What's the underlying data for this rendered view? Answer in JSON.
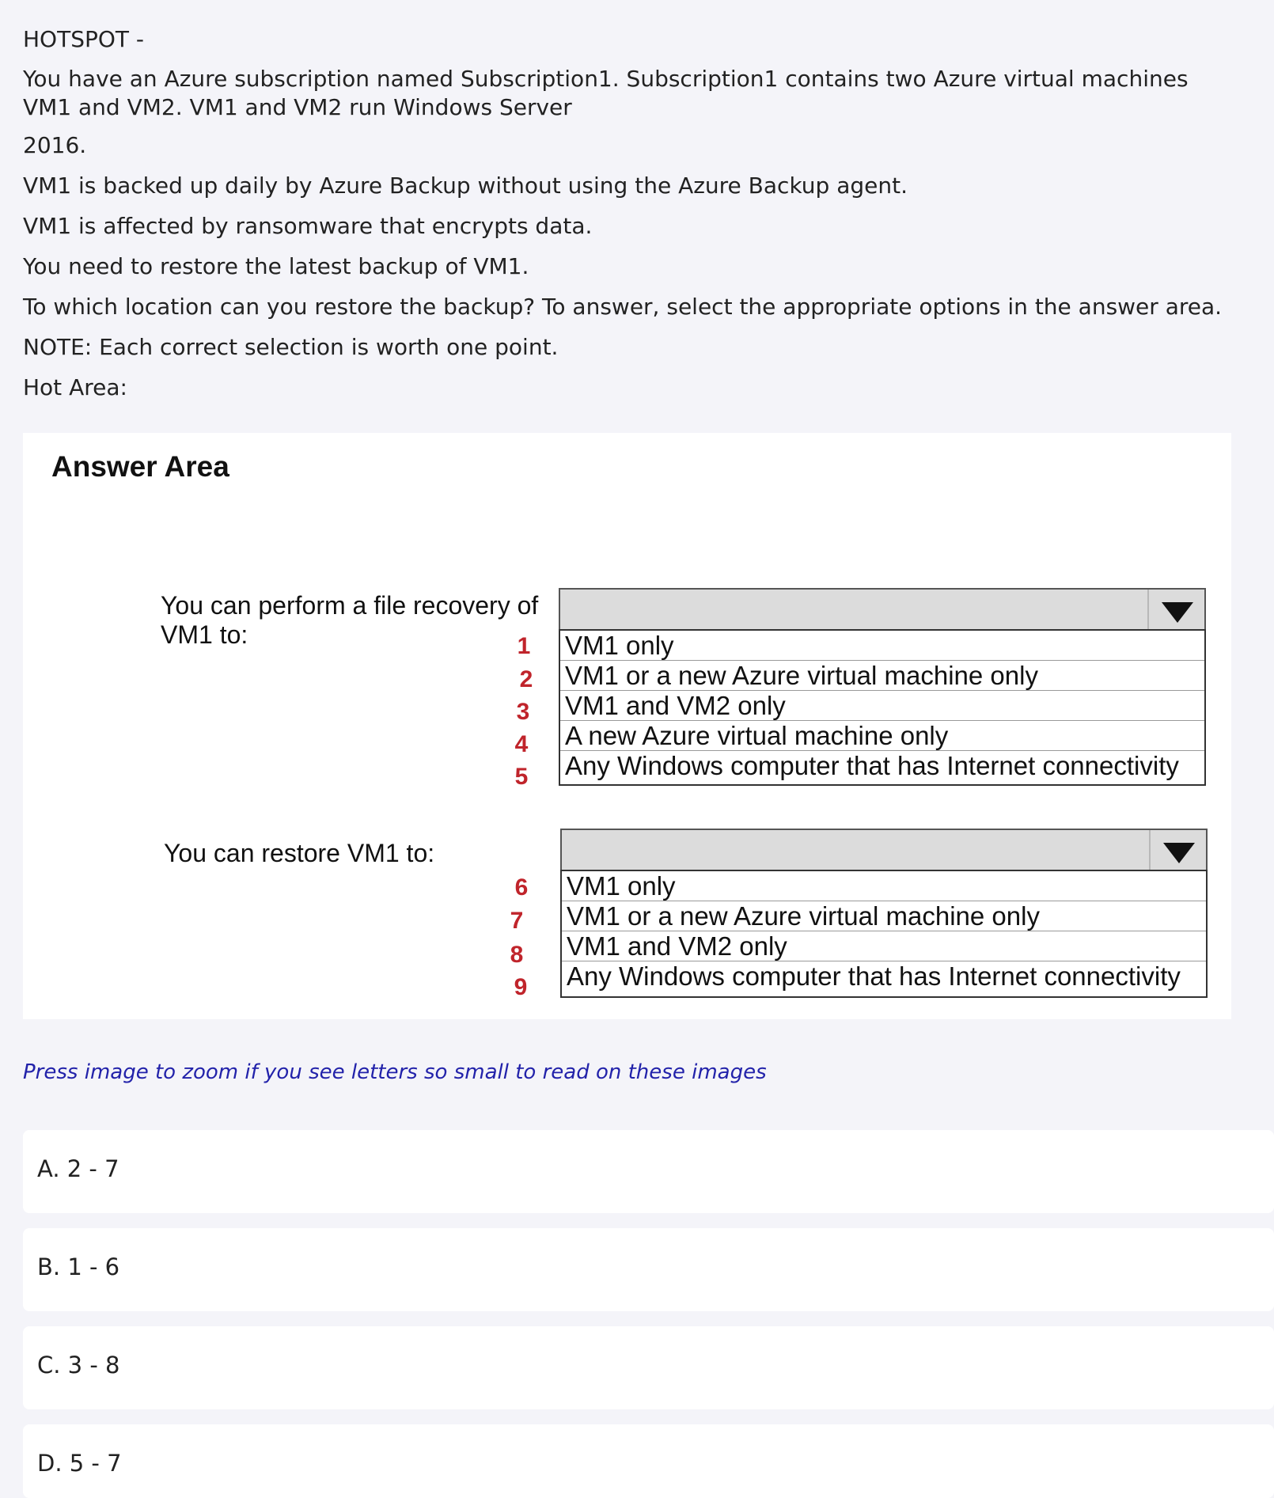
{
  "question": {
    "header": "HOTSPOT -",
    "lines": [
      "You have an Azure subscription named Subscription1. Subscription1 contains two Azure virtual machines VM1 and VM2. VM1 and VM2 run Windows Server",
      "2016.",
      "VM1 is backed up daily by Azure Backup without using the Azure Backup agent.",
      "VM1 is affected by ransomware that encrypts data.",
      "You need to restore the latest backup of VM1.",
      "To which location can you restore the backup? To answer, select the appropriate options in the answer area.",
      "NOTE: Each correct selection is worth one point.",
      "Hot Area:"
    ]
  },
  "answer_area": {
    "title": "Answer Area",
    "statement1": {
      "text_line1": "You can perform a file recovery of",
      "text_line2": "VM1 to:",
      "options": [
        {
          "num": "1",
          "label": "VM1 only"
        },
        {
          "num": "2",
          "label": "VM1 or a new Azure virtual machine only"
        },
        {
          "num": "3",
          "label": "VM1 and VM2 only"
        },
        {
          "num": "4",
          "label": "A new Azure virtual machine only"
        },
        {
          "num": "5",
          "label": "Any Windows computer that has Internet connectivity"
        }
      ]
    },
    "statement2": {
      "text": "You can restore VM1 to:",
      "options": [
        {
          "num": "6",
          "label": "VM1 only"
        },
        {
          "num": "7",
          "label": "VM1 or a new Azure virtual machine only"
        },
        {
          "num": "8",
          "label": "VM1 and VM2 only"
        },
        {
          "num": "9",
          "label": "Any Windows computer that has Internet connectivity"
        }
      ]
    }
  },
  "hint": "Press image to zoom if you see letters so small to read on these images",
  "choices": [
    {
      "label": "A. 2 - 7"
    },
    {
      "label": "B. 1 - 6"
    },
    {
      "label": "C. 3 - 8"
    },
    {
      "label": "D. 5 - 7"
    }
  ],
  "colors": {
    "page_bg": "#f4f4f9",
    "number_red": "#c0242b",
    "hint_blue": "#2222aa"
  }
}
